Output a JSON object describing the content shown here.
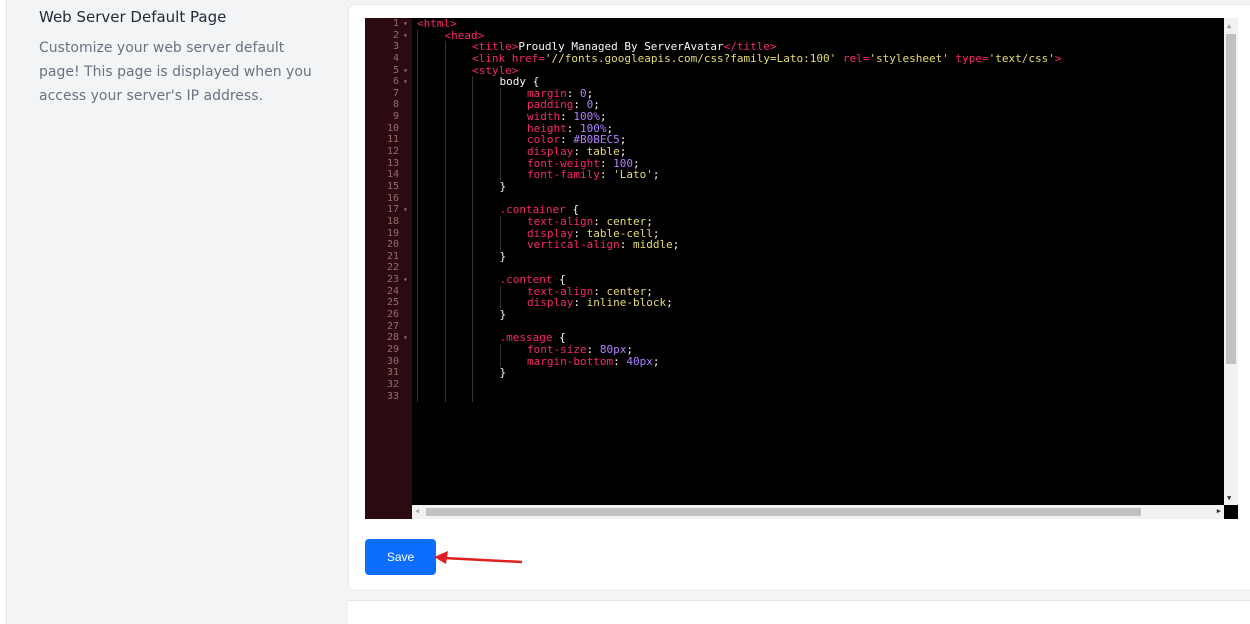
{
  "section": {
    "title": "Web Server Default Page",
    "description": "Customize your web server default page! This page is displayed when you access your server's IP address."
  },
  "editor": {
    "lines": [
      {
        "n": "1",
        "fold": true,
        "indent": 0,
        "parts": [
          [
            "tag",
            "<html>"
          ]
        ]
      },
      {
        "n": "2",
        "fold": true,
        "indent": 1,
        "parts": [
          [
            "tag",
            "<head>"
          ]
        ]
      },
      {
        "n": "3",
        "fold": false,
        "indent": 2,
        "parts": [
          [
            "tag",
            "<title>"
          ],
          [
            "plain",
            "Proudly Managed By ServerAvatar"
          ],
          [
            "tag",
            "</title>"
          ]
        ]
      },
      {
        "n": "4",
        "fold": false,
        "indent": 2,
        "parts": [
          [
            "tag",
            "<link "
          ],
          [
            "attr",
            "href="
          ],
          [
            "str",
            "'//fonts.googleapis.com/css?family=Lato:100'"
          ],
          [
            "attr",
            " rel="
          ],
          [
            "str",
            "'stylesheet'"
          ],
          [
            "attr",
            " type="
          ],
          [
            "str",
            "'text/css'"
          ],
          [
            "tag",
            ">"
          ]
        ]
      },
      {
        "n": "5",
        "fold": true,
        "indent": 2,
        "parts": [
          [
            "tag",
            "<style>"
          ]
        ]
      },
      {
        "n": "6",
        "fold": true,
        "indent": 3,
        "parts": [
          [
            "plain",
            "body {"
          ]
        ]
      },
      {
        "n": "7",
        "fold": false,
        "indent": 4,
        "parts": [
          [
            "sel",
            "margin"
          ],
          [
            "plain",
            ": "
          ],
          [
            "val",
            "0"
          ],
          [
            "plain",
            ";"
          ]
        ]
      },
      {
        "n": "8",
        "fold": false,
        "indent": 4,
        "parts": [
          [
            "sel",
            "padding"
          ],
          [
            "plain",
            ": "
          ],
          [
            "val",
            "0"
          ],
          [
            "plain",
            ";"
          ]
        ]
      },
      {
        "n": "9",
        "fold": false,
        "indent": 4,
        "parts": [
          [
            "sel",
            "width"
          ],
          [
            "plain",
            ": "
          ],
          [
            "val",
            "100%"
          ],
          [
            "plain",
            ";"
          ]
        ]
      },
      {
        "n": "10",
        "fold": false,
        "indent": 4,
        "parts": [
          [
            "sel",
            "height"
          ],
          [
            "plain",
            ": "
          ],
          [
            "val",
            "100%"
          ],
          [
            "plain",
            ";"
          ]
        ]
      },
      {
        "n": "11",
        "fold": false,
        "indent": 4,
        "parts": [
          [
            "sel",
            "color"
          ],
          [
            "plain",
            ": "
          ],
          [
            "val",
            "#B0BEC5"
          ],
          [
            "plain",
            ";"
          ]
        ]
      },
      {
        "n": "12",
        "fold": false,
        "indent": 4,
        "parts": [
          [
            "sel",
            "display"
          ],
          [
            "plain",
            ": "
          ],
          [
            "str",
            "table"
          ],
          [
            "plain",
            ";"
          ]
        ]
      },
      {
        "n": "13",
        "fold": false,
        "indent": 4,
        "parts": [
          [
            "sel",
            "font-weight"
          ],
          [
            "plain",
            ": "
          ],
          [
            "val",
            "100"
          ],
          [
            "plain",
            ";"
          ]
        ]
      },
      {
        "n": "14",
        "fold": false,
        "indent": 4,
        "parts": [
          [
            "sel",
            "font-family"
          ],
          [
            "plain",
            ": "
          ],
          [
            "str",
            "'Lato'"
          ],
          [
            "plain",
            ";"
          ]
        ]
      },
      {
        "n": "15",
        "fold": false,
        "indent": 3,
        "parts": [
          [
            "plain",
            "}"
          ]
        ]
      },
      {
        "n": "16",
        "fold": false,
        "indent": 3,
        "parts": []
      },
      {
        "n": "17",
        "fold": true,
        "indent": 3,
        "parts": [
          [
            "sel",
            ".container"
          ],
          [
            "plain",
            " {"
          ]
        ]
      },
      {
        "n": "18",
        "fold": false,
        "indent": 4,
        "parts": [
          [
            "sel",
            "text-align"
          ],
          [
            "plain",
            ": "
          ],
          [
            "str",
            "center"
          ],
          [
            "plain",
            ";"
          ]
        ]
      },
      {
        "n": "19",
        "fold": false,
        "indent": 4,
        "parts": [
          [
            "sel",
            "display"
          ],
          [
            "plain",
            ": "
          ],
          [
            "str",
            "table-cell"
          ],
          [
            "plain",
            ";"
          ]
        ]
      },
      {
        "n": "20",
        "fold": false,
        "indent": 4,
        "parts": [
          [
            "sel",
            "vertical-align"
          ],
          [
            "plain",
            ": "
          ],
          [
            "str",
            "middle"
          ],
          [
            "plain",
            ";"
          ]
        ]
      },
      {
        "n": "21",
        "fold": false,
        "indent": 3,
        "parts": [
          [
            "plain",
            "}"
          ]
        ]
      },
      {
        "n": "22",
        "fold": false,
        "indent": 3,
        "parts": []
      },
      {
        "n": "23",
        "fold": true,
        "indent": 3,
        "parts": [
          [
            "sel",
            ".content"
          ],
          [
            "plain",
            " {"
          ]
        ]
      },
      {
        "n": "24",
        "fold": false,
        "indent": 4,
        "parts": [
          [
            "sel",
            "text-align"
          ],
          [
            "plain",
            ": "
          ],
          [
            "str",
            "center"
          ],
          [
            "plain",
            ";"
          ]
        ]
      },
      {
        "n": "25",
        "fold": false,
        "indent": 4,
        "parts": [
          [
            "sel",
            "display"
          ],
          [
            "plain",
            ": "
          ],
          [
            "str",
            "inline-block"
          ],
          [
            "plain",
            ";"
          ]
        ]
      },
      {
        "n": "26",
        "fold": false,
        "indent": 3,
        "parts": [
          [
            "plain",
            "}"
          ]
        ]
      },
      {
        "n": "27",
        "fold": false,
        "indent": 3,
        "parts": []
      },
      {
        "n": "28",
        "fold": true,
        "indent": 3,
        "parts": [
          [
            "sel",
            ".message"
          ],
          [
            "plain",
            " {"
          ]
        ]
      },
      {
        "n": "29",
        "fold": false,
        "indent": 4,
        "parts": [
          [
            "sel",
            "font-size"
          ],
          [
            "plain",
            ": "
          ],
          [
            "val",
            "80px"
          ],
          [
            "plain",
            ";"
          ]
        ]
      },
      {
        "n": "30",
        "fold": false,
        "indent": 4,
        "parts": [
          [
            "sel",
            "margin-bottom"
          ],
          [
            "plain",
            ": "
          ],
          [
            "val",
            "40px"
          ],
          [
            "plain",
            ";"
          ]
        ]
      },
      {
        "n": "31",
        "fold": false,
        "indent": 3,
        "parts": [
          [
            "plain",
            "}"
          ]
        ]
      },
      {
        "n": "32",
        "fold": false,
        "indent": 3,
        "parts": []
      },
      {
        "n": "33",
        "fold": false,
        "indent": 3,
        "parts": []
      }
    ]
  },
  "actions": {
    "save_label": "Save"
  },
  "colors": {
    "primary_button": "#0d6efd",
    "annotation_arrow": "#e02020"
  }
}
